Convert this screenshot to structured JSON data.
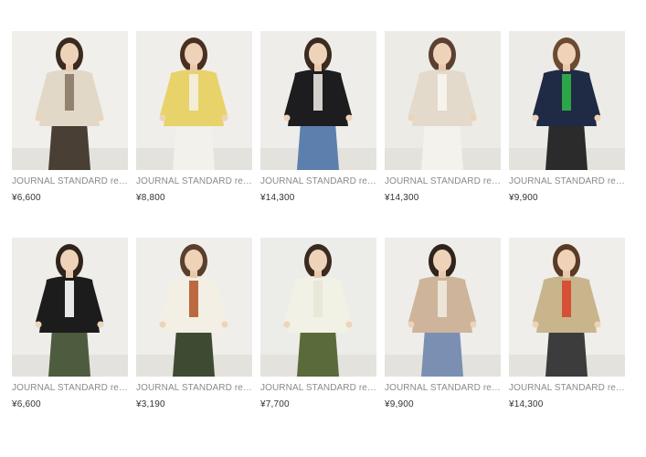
{
  "products": [
    {
      "brand": "JOURNAL STANDARD relu…",
      "price": "¥6,600",
      "bg": "#f1efeb",
      "top": "#e2d8c8",
      "bottom": "#4a3f35",
      "hair": "#3a2a20",
      "accent": "#8a7a66"
    },
    {
      "brand": "JOURNAL STANDARD relu…",
      "price": "¥8,800",
      "bg": "#f0eeea",
      "top": "#e8d36a",
      "bottom": "#f3f1ec",
      "hair": "#4a2f22",
      "accent": "#f4efe4"
    },
    {
      "brand": "JOURNAL STANDARD relu…",
      "price": "¥14,300",
      "bg": "#eeede9",
      "top": "#1d1d1f",
      "bottom": "#5d7fae",
      "hair": "#3a2a20",
      "accent": "#e9e6df"
    },
    {
      "brand": "JOURNAL STANDARD relu…",
      "price": "¥14,300",
      "bg": "#ecebe6",
      "top": "#e3dacb",
      "bottom": "#f4f2ed",
      "hair": "#5a4030",
      "accent": "#f7f5f0"
    },
    {
      "brand": "JOURNAL STANDARD relu…",
      "price": "¥9,900",
      "bg": "#ecebe8",
      "top": "#1f2a44",
      "bottom": "#2b2b2b",
      "hair": "#6b4a30",
      "accent": "#2fb34a"
    },
    {
      "brand": "JOURNAL STANDARD relu…",
      "price": "¥6,600",
      "bg": "#eeedea",
      "top": "#1c1c1c",
      "bottom": "#4d5b3f",
      "hair": "#2f241d",
      "accent": "#ffffff"
    },
    {
      "brand": "JOURNAL STANDARD relu…",
      "price": "¥3,190",
      "bg": "#efeeeb",
      "top": "#f3efe4",
      "bottom": "#3f4a33",
      "hair": "#5a3f2c",
      "accent": "#b55a2c"
    },
    {
      "brand": "JOURNAL STANDARD relu…",
      "price": "¥7,700",
      "bg": "#ecece8",
      "top": "#f2f1e6",
      "bottom": "#5b6a3a",
      "hair": "#3a2a20",
      "accent": "#e8e6d6"
    },
    {
      "brand": "JOURNAL STANDARD relu…",
      "price": "¥9,900",
      "bg": "#eeedea",
      "top": "#cdb49a",
      "bottom": "#7b8fb3",
      "hair": "#2f241d",
      "accent": "#efe9dd"
    },
    {
      "brand": "JOURNAL STANDARD relu…",
      "price": "¥14,300",
      "bg": "#efeeeb",
      "top": "#c9b58c",
      "bottom": "#3c3c3c",
      "hair": "#5a3a25",
      "accent": "#d8452c"
    }
  ]
}
